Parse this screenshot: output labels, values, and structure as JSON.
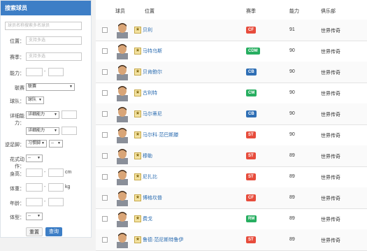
{
  "sidebar": {
    "title": "搜索球员",
    "search_placeholder": "球员名称搜索多名球员",
    "position_label": "位置：",
    "position_placeholder": "支持多选",
    "league_label": "赛季：",
    "league_placeholder": "支持多选",
    "ability_label": "能力：",
    "union_label": "联赛",
    "union_value": "联赛",
    "team_label": "球队：",
    "team_value": "球队",
    "detail_label": "详细能力：",
    "detail_value_1": "详细能力",
    "detail_value_2": "详细能力",
    "foot_label": "逆足脚：",
    "foot_value": "习惯脚",
    "foot_value_2": "--",
    "skill_label": "花式动作：",
    "skill_value": "--",
    "height_label": "身高：",
    "height_unit": "cm",
    "weight_label": "体重：",
    "weight_unit": "kg",
    "age_label": "年龄：",
    "body_label": "体型：",
    "body_value": "--",
    "reset_label": "重置",
    "search_label": "查询"
  },
  "table": {
    "headers": [
      "球员",
      "位置",
      "赛季",
      "能力",
      "俱乐部"
    ],
    "rows": [
      {
        "name": "贝利",
        "pos": "CF",
        "color": "#e74c3c",
        "rating": "91",
        "club": "世界传奇"
      },
      {
        "name": "马特乌斯",
        "pos": "CDM",
        "color": "#27ae60",
        "rating": "90",
        "club": "世界传奇"
      },
      {
        "name": "贝肯鲍尔",
        "pos": "CB",
        "color": "#2f6fb5",
        "rating": "90",
        "club": "世界传奇"
      },
      {
        "name": "古利特",
        "pos": "CM",
        "color": "#27ae60",
        "rating": "90",
        "club": "世界传奇"
      },
      {
        "name": "马尔蒂尼",
        "pos": "CB",
        "color": "#2f6fb5",
        "rating": "90",
        "club": "世界传奇"
      },
      {
        "name": "马尔科·范巴斯滕",
        "pos": "ST",
        "color": "#e74c3c",
        "rating": "90",
        "club": "世界传奇"
      },
      {
        "name": "穆勒",
        "pos": "ST",
        "color": "#e74c3c",
        "rating": "89",
        "club": "世界传奇"
      },
      {
        "name": "尼扎比",
        "pos": "ST",
        "color": "#e74c3c",
        "rating": "89",
        "club": "世界传奇"
      },
      {
        "name": "博格坎普",
        "pos": "CF",
        "color": "#e74c3c",
        "rating": "89",
        "club": "世界传奇"
      },
      {
        "name": "费戈",
        "pos": "RM",
        "color": "#27ae60",
        "rating": "89",
        "club": "世界传奇"
      },
      {
        "name": "鲁德·范尼斯特鲁伊",
        "pos": "ST",
        "color": "#e74c3c",
        "rating": "89",
        "club": "世界传奇"
      }
    ]
  }
}
